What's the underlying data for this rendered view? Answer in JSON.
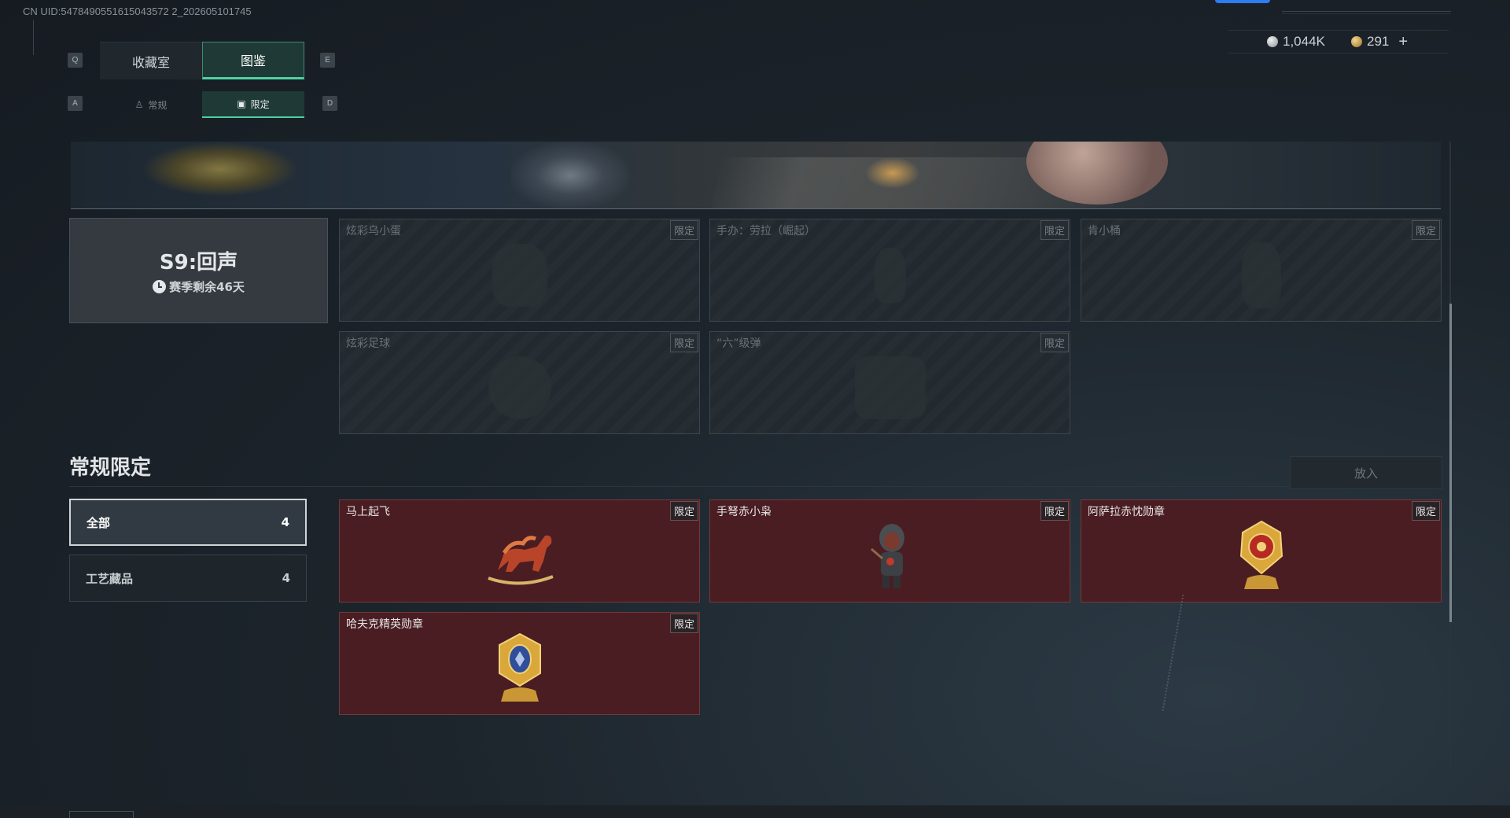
{
  "uid": "CN UID:5478490551615043572 2_202605101745",
  "keys": {
    "prev_tab": "Q",
    "next_tab": "E",
    "prev_sub": "A",
    "next_sub": "D"
  },
  "tabs": {
    "main": [
      "收藏室",
      "图鉴"
    ],
    "sub": [
      "常规",
      "限定"
    ]
  },
  "currency": {
    "silver": "1,044K",
    "gold": "291",
    "add": "+"
  },
  "season": {
    "title": "S9:回声",
    "remaining": "赛季剩余46天"
  },
  "season_items": [
    {
      "name": "炫彩乌小蛋",
      "tag": "限定",
      "icon": "egg-bird-silhouette-icon"
    },
    {
      "name": "手办：劳拉（崛起）",
      "tag": "限定",
      "icon": "figure-silhouette-icon"
    },
    {
      "name": "肯小桶",
      "tag": "限定",
      "icon": "bucket-silhouette-icon"
    },
    {
      "name": "炫彩足球",
      "tag": "限定",
      "icon": "football-silhouette-icon"
    },
    {
      "name": "“六”级弹",
      "tag": "限定",
      "icon": "bullets-silhouette-icon"
    }
  ],
  "section": {
    "title": "常规限定",
    "place_button": "放入"
  },
  "filters": [
    {
      "label": "全部",
      "count": "4"
    },
    {
      "label": "工艺藏品",
      "count": "4"
    }
  ],
  "regular_items": [
    {
      "name": "马上起飞",
      "tag": "限定",
      "icon": "rocking-horse-icon"
    },
    {
      "name": "手弩赤小枭",
      "tag": "限定",
      "icon": "hooded-figure-icon"
    },
    {
      "name": "阿萨拉赤忱勋章",
      "tag": "限定",
      "icon": "gold-medal-icon"
    },
    {
      "name": "哈夫克精英勋章",
      "tag": "限定",
      "icon": "blue-medal-icon"
    }
  ],
  "colors": {
    "accent": "#4fd0a0",
    "owned_card": "#4a1d22",
    "locked_card": "#232a2f"
  }
}
